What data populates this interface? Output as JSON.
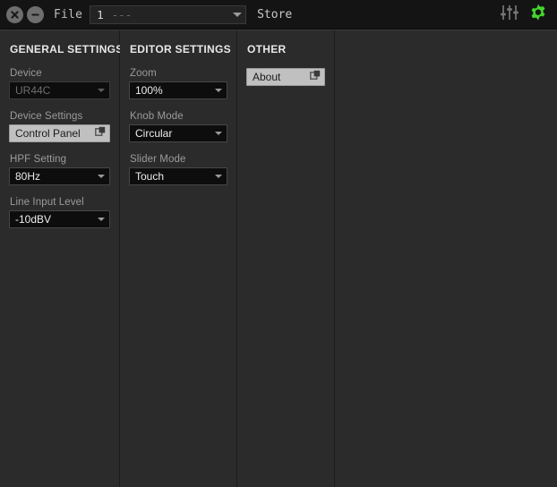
{
  "toolbar": {
    "close_icon": "close-icon",
    "minimize_icon": "minimize-icon",
    "file_label": "File",
    "preset": {
      "number": "1",
      "name": "---"
    },
    "store_label": "Store",
    "mixer_icon": "faders-icon",
    "settings_icon": "gear-icon",
    "settings_icon_color": "#44d62c"
  },
  "columns": [
    {
      "title": "GENERAL SETTINGS",
      "fields": [
        {
          "label": "Device",
          "type": "dropdown",
          "value": "UR44C",
          "disabled": true
        },
        {
          "label": "Device Settings",
          "type": "button",
          "value": "Control Panel"
        },
        {
          "label": "HPF Setting",
          "type": "dropdown",
          "value": "80Hz",
          "disabled": false
        },
        {
          "label": "Line Input Level",
          "type": "dropdown",
          "value": "-10dBV",
          "disabled": false
        }
      ]
    },
    {
      "title": "EDITOR SETTINGS",
      "fields": [
        {
          "label": "Zoom",
          "type": "dropdown",
          "value": "100%",
          "disabled": false
        },
        {
          "label": "Knob Mode",
          "type": "dropdown",
          "value": "Circular",
          "disabled": false
        },
        {
          "label": "Slider Mode",
          "type": "dropdown",
          "value": "Touch",
          "disabled": false
        }
      ]
    },
    {
      "title": "OTHER",
      "fields": [
        {
          "label": "",
          "type": "button",
          "value": "About"
        }
      ]
    }
  ]
}
